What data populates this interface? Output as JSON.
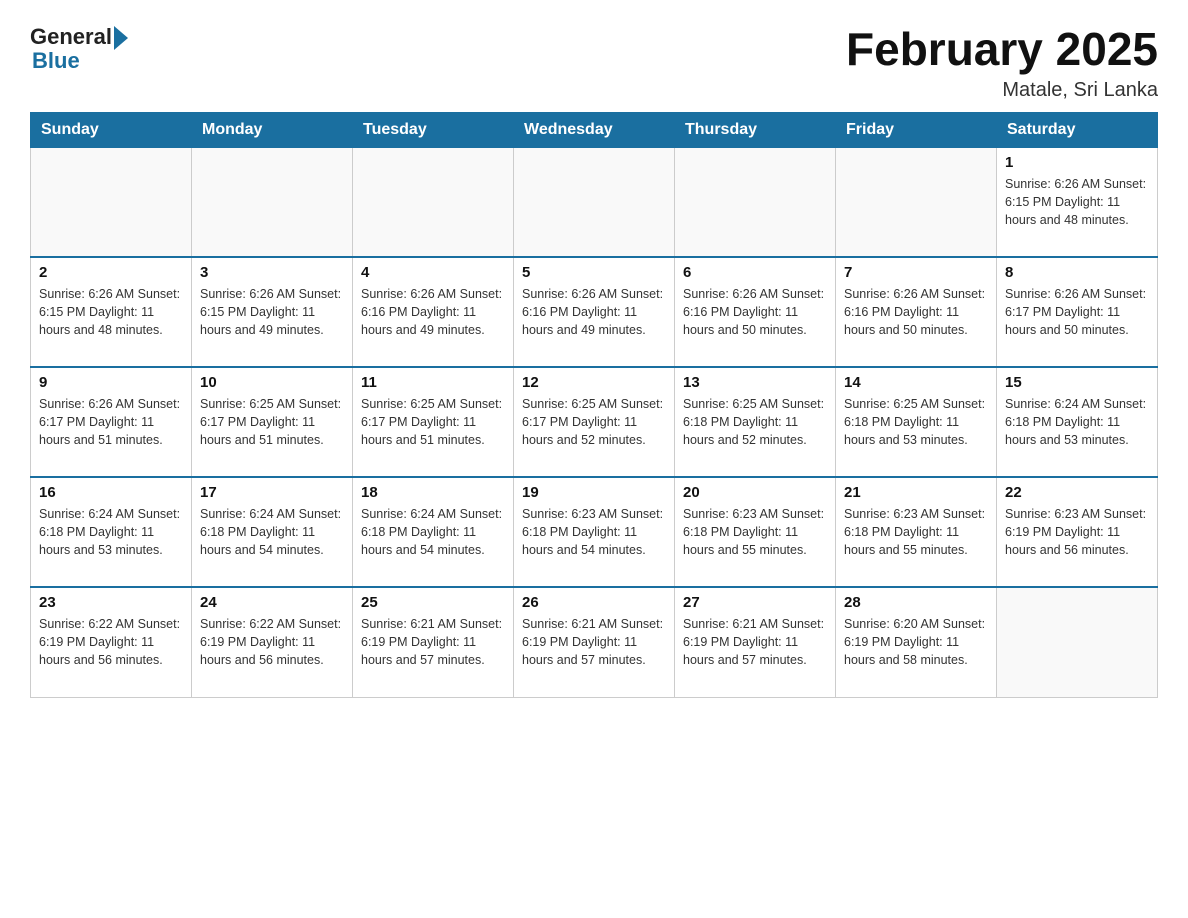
{
  "logo": {
    "general": "General",
    "blue": "Blue"
  },
  "title": "February 2025",
  "subtitle": "Matale, Sri Lanka",
  "days_of_week": [
    "Sunday",
    "Monday",
    "Tuesday",
    "Wednesday",
    "Thursday",
    "Friday",
    "Saturday"
  ],
  "weeks": [
    [
      {
        "day": "",
        "info": ""
      },
      {
        "day": "",
        "info": ""
      },
      {
        "day": "",
        "info": ""
      },
      {
        "day": "",
        "info": ""
      },
      {
        "day": "",
        "info": ""
      },
      {
        "day": "",
        "info": ""
      },
      {
        "day": "1",
        "info": "Sunrise: 6:26 AM\nSunset: 6:15 PM\nDaylight: 11 hours\nand 48 minutes."
      }
    ],
    [
      {
        "day": "2",
        "info": "Sunrise: 6:26 AM\nSunset: 6:15 PM\nDaylight: 11 hours\nand 48 minutes."
      },
      {
        "day": "3",
        "info": "Sunrise: 6:26 AM\nSunset: 6:15 PM\nDaylight: 11 hours\nand 49 minutes."
      },
      {
        "day": "4",
        "info": "Sunrise: 6:26 AM\nSunset: 6:16 PM\nDaylight: 11 hours\nand 49 minutes."
      },
      {
        "day": "5",
        "info": "Sunrise: 6:26 AM\nSunset: 6:16 PM\nDaylight: 11 hours\nand 49 minutes."
      },
      {
        "day": "6",
        "info": "Sunrise: 6:26 AM\nSunset: 6:16 PM\nDaylight: 11 hours\nand 50 minutes."
      },
      {
        "day": "7",
        "info": "Sunrise: 6:26 AM\nSunset: 6:16 PM\nDaylight: 11 hours\nand 50 minutes."
      },
      {
        "day": "8",
        "info": "Sunrise: 6:26 AM\nSunset: 6:17 PM\nDaylight: 11 hours\nand 50 minutes."
      }
    ],
    [
      {
        "day": "9",
        "info": "Sunrise: 6:26 AM\nSunset: 6:17 PM\nDaylight: 11 hours\nand 51 minutes."
      },
      {
        "day": "10",
        "info": "Sunrise: 6:25 AM\nSunset: 6:17 PM\nDaylight: 11 hours\nand 51 minutes."
      },
      {
        "day": "11",
        "info": "Sunrise: 6:25 AM\nSunset: 6:17 PM\nDaylight: 11 hours\nand 51 minutes."
      },
      {
        "day": "12",
        "info": "Sunrise: 6:25 AM\nSunset: 6:17 PM\nDaylight: 11 hours\nand 52 minutes."
      },
      {
        "day": "13",
        "info": "Sunrise: 6:25 AM\nSunset: 6:18 PM\nDaylight: 11 hours\nand 52 minutes."
      },
      {
        "day": "14",
        "info": "Sunrise: 6:25 AM\nSunset: 6:18 PM\nDaylight: 11 hours\nand 53 minutes."
      },
      {
        "day": "15",
        "info": "Sunrise: 6:24 AM\nSunset: 6:18 PM\nDaylight: 11 hours\nand 53 minutes."
      }
    ],
    [
      {
        "day": "16",
        "info": "Sunrise: 6:24 AM\nSunset: 6:18 PM\nDaylight: 11 hours\nand 53 minutes."
      },
      {
        "day": "17",
        "info": "Sunrise: 6:24 AM\nSunset: 6:18 PM\nDaylight: 11 hours\nand 54 minutes."
      },
      {
        "day": "18",
        "info": "Sunrise: 6:24 AM\nSunset: 6:18 PM\nDaylight: 11 hours\nand 54 minutes."
      },
      {
        "day": "19",
        "info": "Sunrise: 6:23 AM\nSunset: 6:18 PM\nDaylight: 11 hours\nand 54 minutes."
      },
      {
        "day": "20",
        "info": "Sunrise: 6:23 AM\nSunset: 6:18 PM\nDaylight: 11 hours\nand 55 minutes."
      },
      {
        "day": "21",
        "info": "Sunrise: 6:23 AM\nSunset: 6:18 PM\nDaylight: 11 hours\nand 55 minutes."
      },
      {
        "day": "22",
        "info": "Sunrise: 6:23 AM\nSunset: 6:19 PM\nDaylight: 11 hours\nand 56 minutes."
      }
    ],
    [
      {
        "day": "23",
        "info": "Sunrise: 6:22 AM\nSunset: 6:19 PM\nDaylight: 11 hours\nand 56 minutes."
      },
      {
        "day": "24",
        "info": "Sunrise: 6:22 AM\nSunset: 6:19 PM\nDaylight: 11 hours\nand 56 minutes."
      },
      {
        "day": "25",
        "info": "Sunrise: 6:21 AM\nSunset: 6:19 PM\nDaylight: 11 hours\nand 57 minutes."
      },
      {
        "day": "26",
        "info": "Sunrise: 6:21 AM\nSunset: 6:19 PM\nDaylight: 11 hours\nand 57 minutes."
      },
      {
        "day": "27",
        "info": "Sunrise: 6:21 AM\nSunset: 6:19 PM\nDaylight: 11 hours\nand 57 minutes."
      },
      {
        "day": "28",
        "info": "Sunrise: 6:20 AM\nSunset: 6:19 PM\nDaylight: 11 hours\nand 58 minutes."
      },
      {
        "day": "",
        "info": ""
      }
    ]
  ]
}
